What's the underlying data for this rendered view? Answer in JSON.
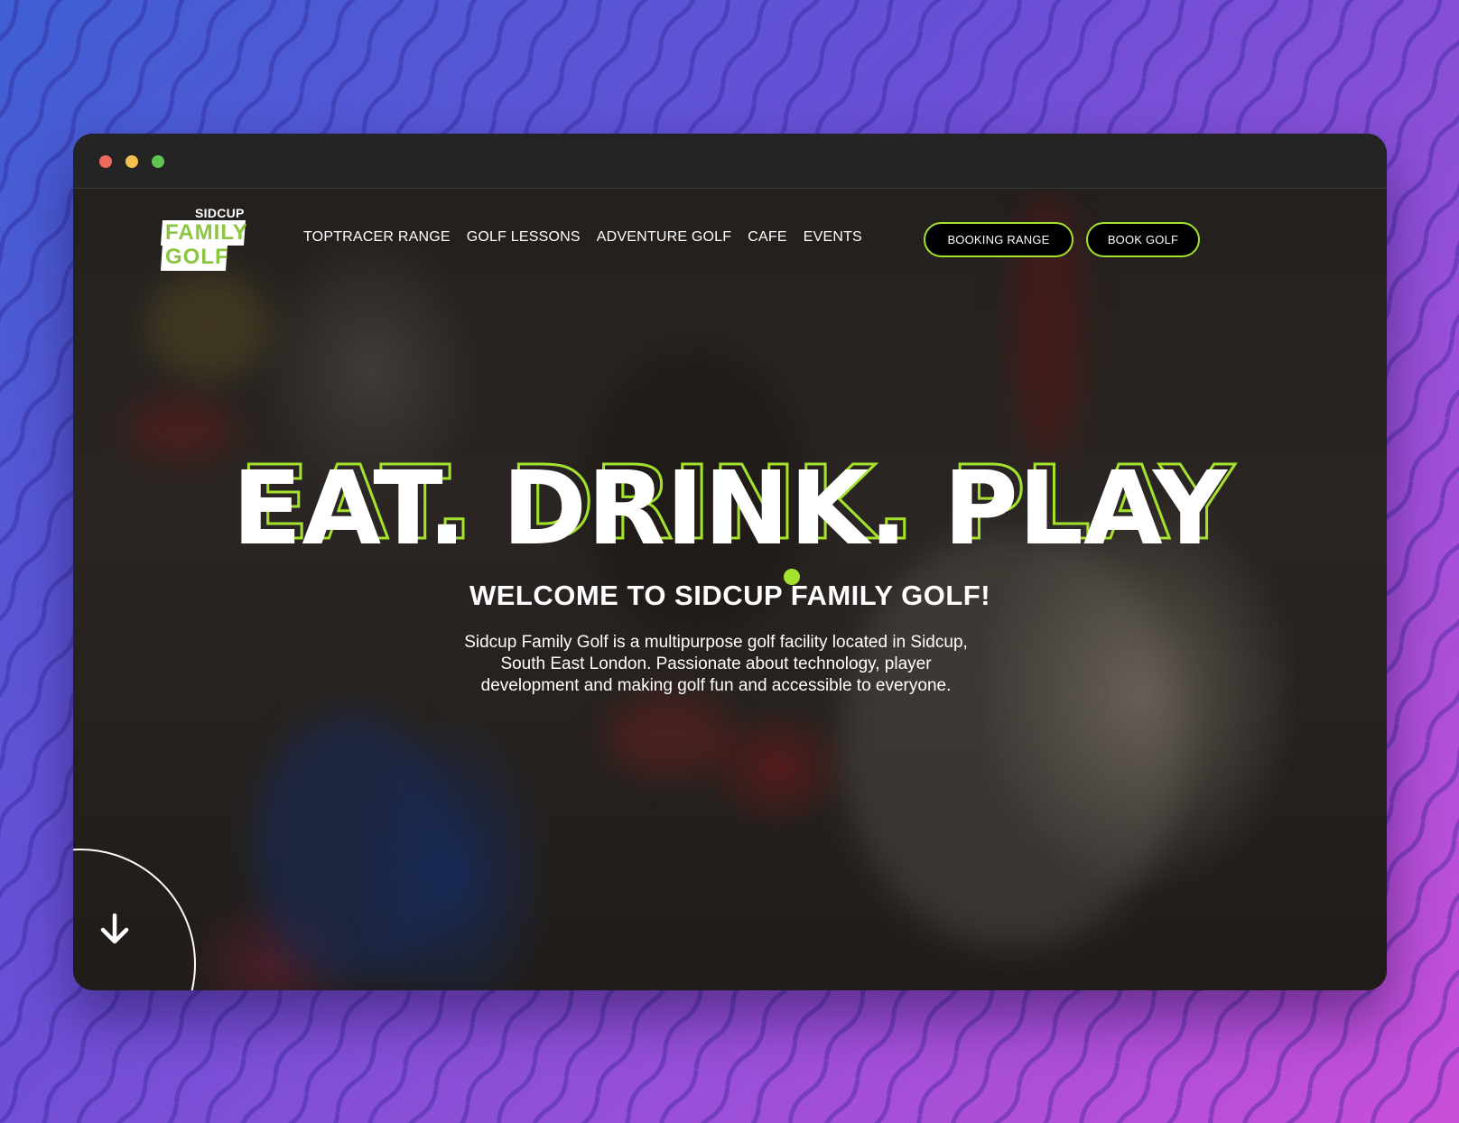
{
  "window": {
    "controls": [
      "close",
      "minimize",
      "maximize"
    ]
  },
  "logo": {
    "top": "SIDCUP",
    "line1": "FAMILY",
    "line2": "GOLF"
  },
  "nav": {
    "items": [
      "TOPTRACER RANGE",
      "GOLF LESSONS",
      "ADVENTURE GOLF",
      "CAFE",
      "EVENTS"
    ]
  },
  "buttons": {
    "booking_range": "BOOKING RANGE",
    "book_golf": "BOOK GOLF"
  },
  "hero": {
    "title": "EAT. DRINK. PLAY",
    "welcome": "WELCOME TO SIDCUP FAMILY GOLF!",
    "intro": "Sidcup Family Golf is a multipurpose golf facility located in Sidcup, South East London. Passionate about technology, player development and making golf fun and accessible to everyone."
  },
  "scroll": {
    "icon": "arrow-down-icon"
  },
  "colors": {
    "accent": "#a4e22e",
    "logo_green": "#8cc63f",
    "frame_bg_start": "#3f5fd4",
    "frame_bg_end": "#c94fd8"
  }
}
